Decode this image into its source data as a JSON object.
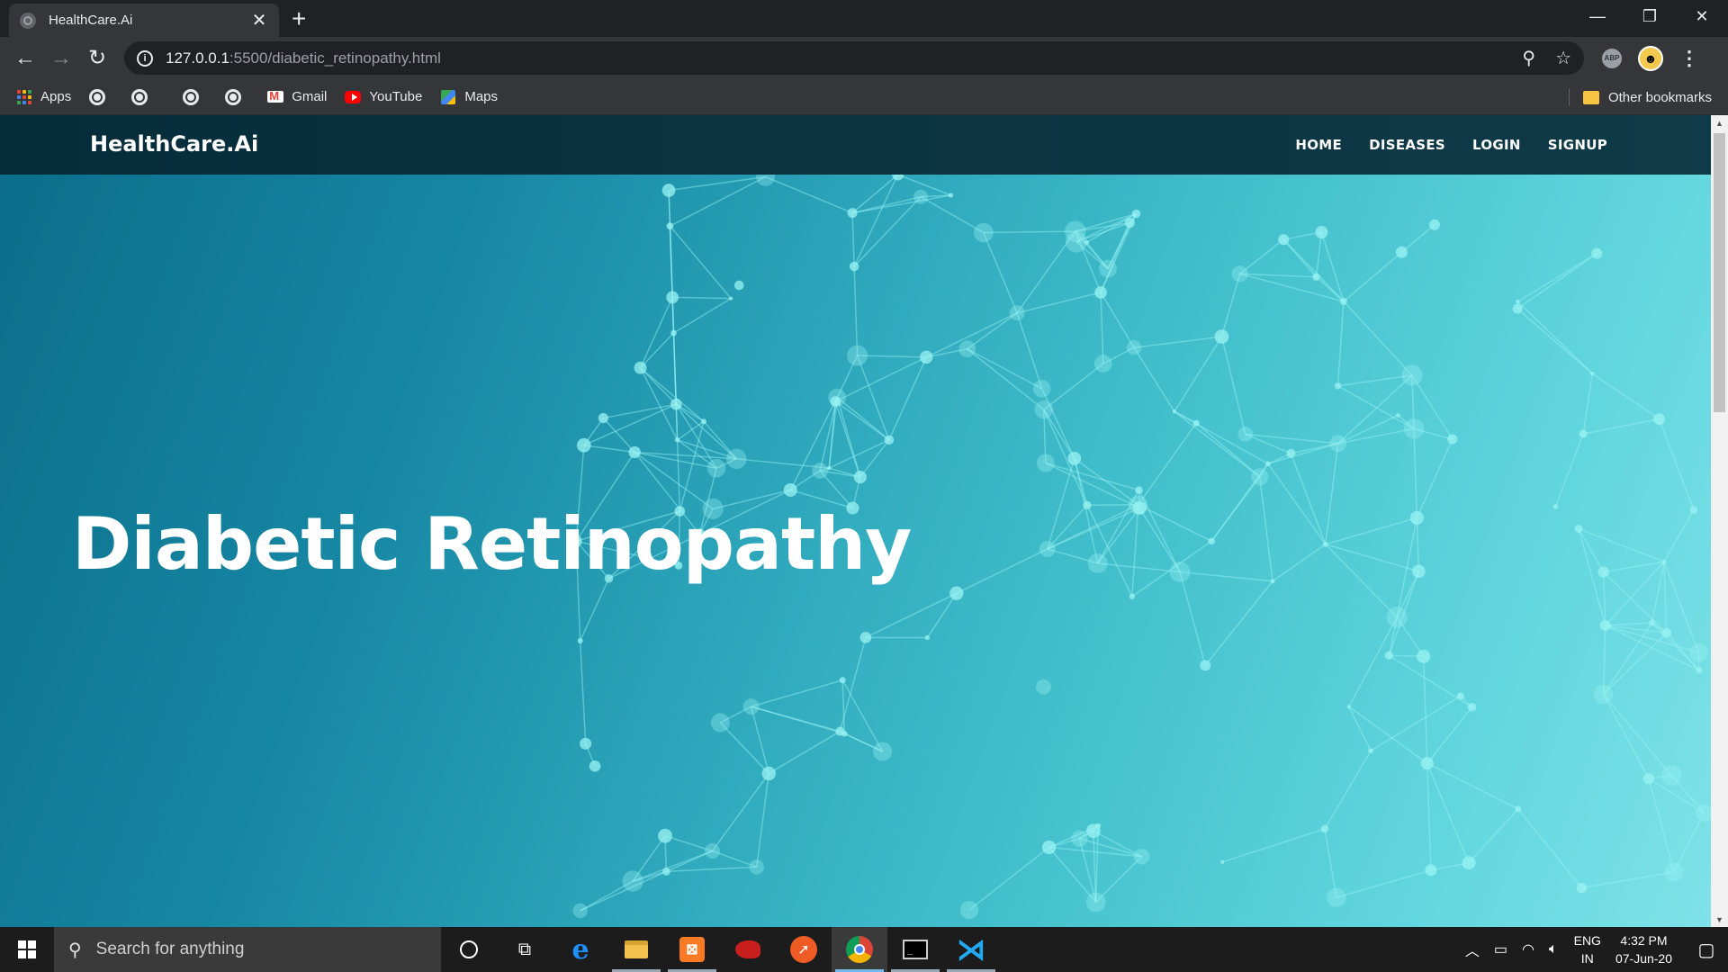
{
  "browser": {
    "tab_title": "HealthCare.Ai",
    "url_host": "127.0.0.1",
    "url_rest": ":5500/diabetic_retinopathy.html",
    "bookmarks": [
      {
        "label": "Apps",
        "icon": "apps-grid-icon"
      },
      {
        "label": "",
        "icon": "globe-icon"
      },
      {
        "label": "",
        "icon": "globe-icon"
      },
      {
        "label": "",
        "icon": "globe-icon"
      },
      {
        "label": "",
        "icon": "globe-icon"
      },
      {
        "label": "Gmail",
        "icon": "gmail-icon"
      },
      {
        "label": "YouTube",
        "icon": "youtube-icon"
      },
      {
        "label": "Maps",
        "icon": "maps-icon"
      }
    ],
    "other_bookmarks": "Other bookmarks",
    "abp_label": "ABP"
  },
  "site": {
    "brand": "HealthCare.Ai",
    "nav": [
      "HOME",
      "DISEASES",
      "LOGIN",
      "SIGNUP"
    ],
    "hero_title": "Diabetic Retinopathy",
    "colors": {
      "nav_bg": "#062c3a",
      "hero_dark": "#0b6d8a",
      "hero_light": "#7fe2e8",
      "network_node": "#9af3f3"
    }
  },
  "taskbar": {
    "search_placeholder": "Search for anything",
    "language": "ENG",
    "region": "IN",
    "time": "4:32 PM",
    "date": "07-Jun-20",
    "apps": [
      "cortana-icon",
      "task-view-icon",
      "edge-icon",
      "file-explorer-icon",
      "xampp-icon",
      "red-app-icon",
      "postman-icon",
      "chrome-icon",
      "terminal-icon",
      "vscode-icon"
    ]
  }
}
